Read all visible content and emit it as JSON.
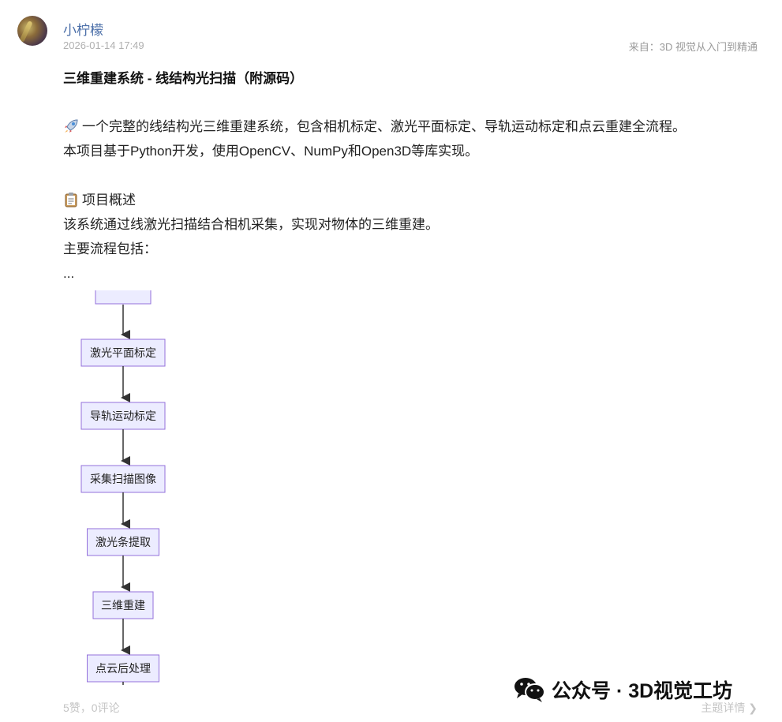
{
  "post": {
    "author": "小柠檬",
    "time": "2026-01-14 17:49",
    "source": "来自：3D 视觉从入门到精通",
    "title": "三维重建系统 - 线结构光扫描（附源码）",
    "body": {
      "line1": "一个完整的线结构光三维重建系统，包含相机标定、激光平面标定、导轨运动标定和点云重建全流程。",
      "line2": "本项目基于Python开发，使用OpenCV、NumPy和Open3D等库实现。",
      "section_heading": "项目概述",
      "line3": "该系统通过线激光扫描结合相机采集，实现对物体的三维重建。",
      "line4": "主要流程包括：",
      "ellipsis": "..."
    }
  },
  "flowchart": {
    "nodes": [
      "激光平面标定",
      "导轨运动标定",
      "采集扫描图像",
      "激光条提取",
      "三维重建",
      "点云后处理"
    ],
    "node_fill": "#ececff",
    "node_border": "#9370db"
  },
  "footer": {
    "stats": "5赞，0评论",
    "more": "主题详情 ❯"
  },
  "watermark": {
    "text": "公众号 · 3D视觉工坊",
    "icon": "wechat-icon"
  },
  "colors": {
    "author": "#4a6ea8",
    "meta": "#b0b0b0"
  }
}
